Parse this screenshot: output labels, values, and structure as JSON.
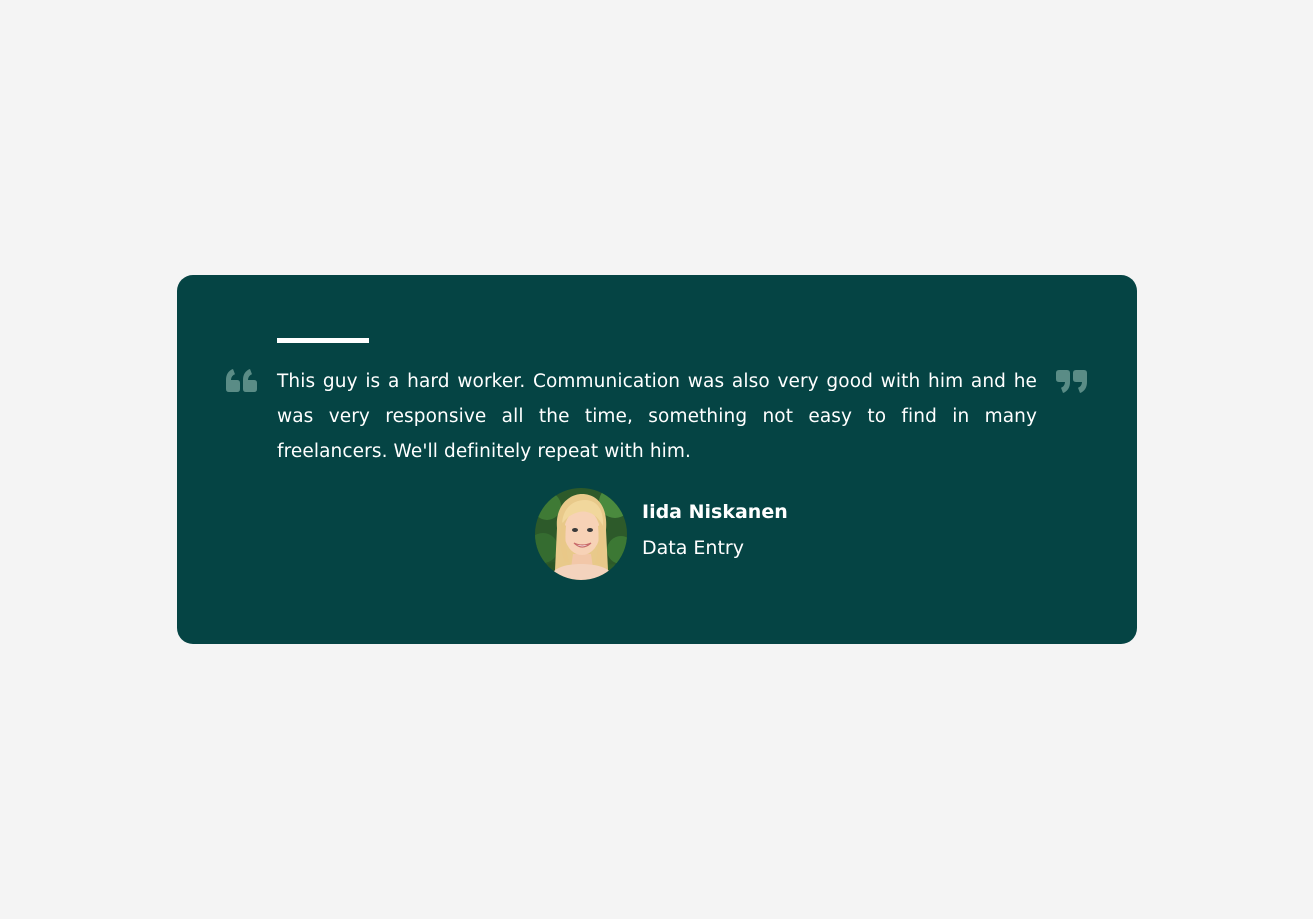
{
  "testimonial": {
    "quote": "This guy is a hard worker. Communication was also very good with him and he was very responsive all the time, something not easy to find in many freelancers. We'll definitely repeat with him.",
    "author_name": "Iida Niskanen",
    "author_role": "Data Entry",
    "avatar_icon": "avatar-photo",
    "open_quote_icon": "quote-open-icon",
    "close_quote_icon": "quote-close-icon"
  },
  "colors": {
    "page_background": "#f4f4f4",
    "card_background": "#054444",
    "text": "#ffffff",
    "quote_icon": "#5a8c86"
  }
}
